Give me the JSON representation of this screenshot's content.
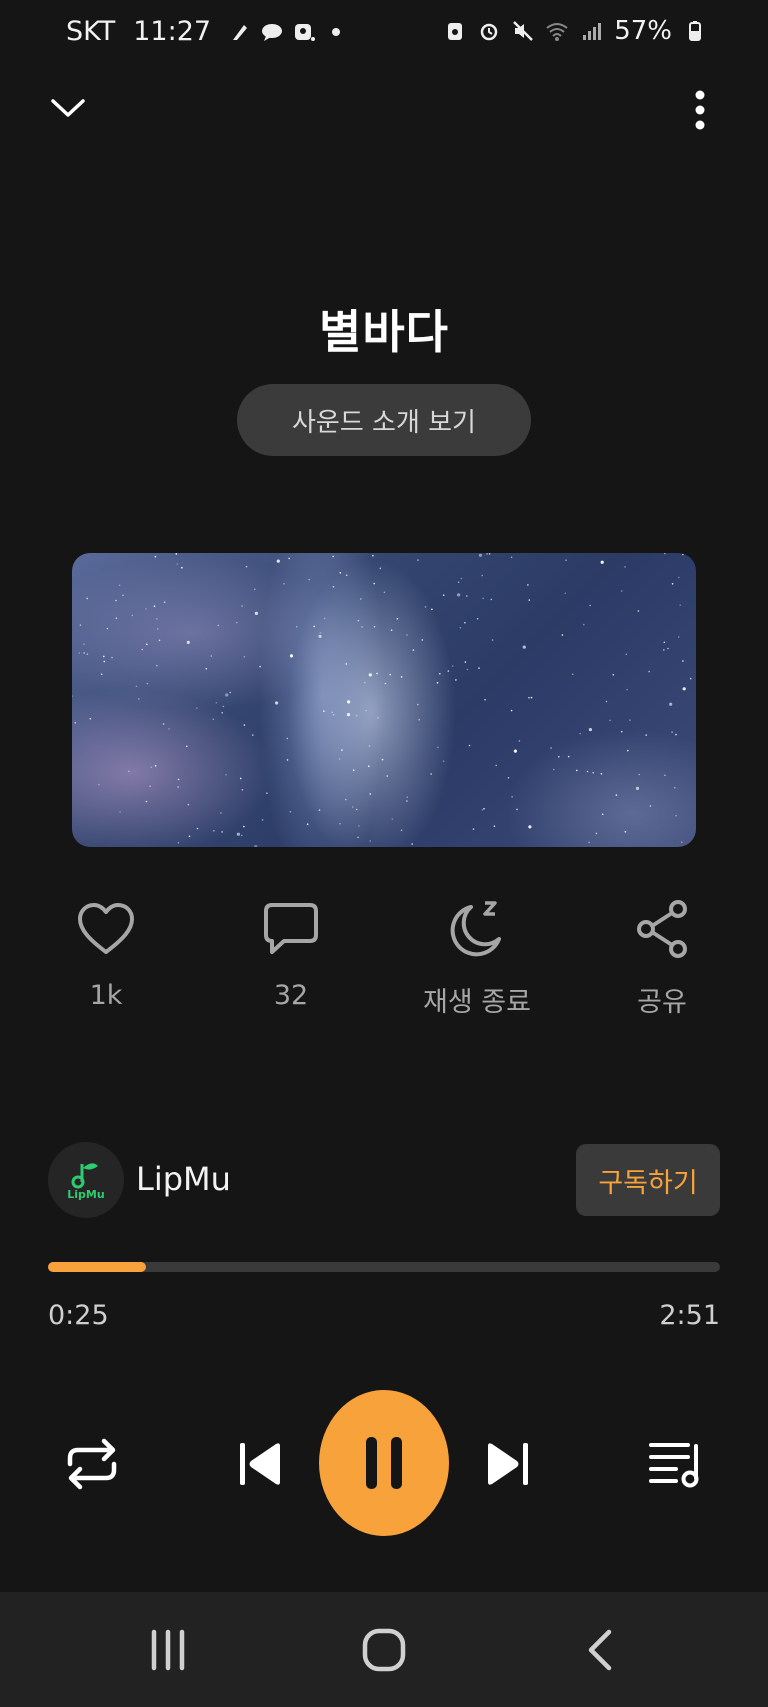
{
  "status_bar": {
    "carrier": "SKT",
    "time": "11:27",
    "battery": "57%"
  },
  "sound": {
    "title": "별바다",
    "intro_button": "사운드 소개 보기"
  },
  "actions": {
    "like_count": "1k",
    "comment_count": "32",
    "sleep_timer_label": "재생 종료",
    "share_label": "공유"
  },
  "channel": {
    "name": "LipMu",
    "logo_text": "LipMu",
    "subscribe_label": "구독하기"
  },
  "playback": {
    "elapsed": "0:25",
    "duration": "2:51",
    "progress": 0.146,
    "state": "playing"
  },
  "colors": {
    "accent": "#f7a23a",
    "background": "#151515",
    "logo_green": "#2ecc71"
  },
  "icons": {
    "collapse": "chevron-down-icon",
    "more": "more-vertical-icon",
    "like": "heart-icon",
    "comment": "comment-icon",
    "sleep": "moon-sleep-icon",
    "share": "share-icon",
    "repeat": "repeat-icon",
    "previous": "skip-previous-icon",
    "pause": "pause-icon",
    "next": "skip-next-icon",
    "playlist": "playlist-icon"
  }
}
